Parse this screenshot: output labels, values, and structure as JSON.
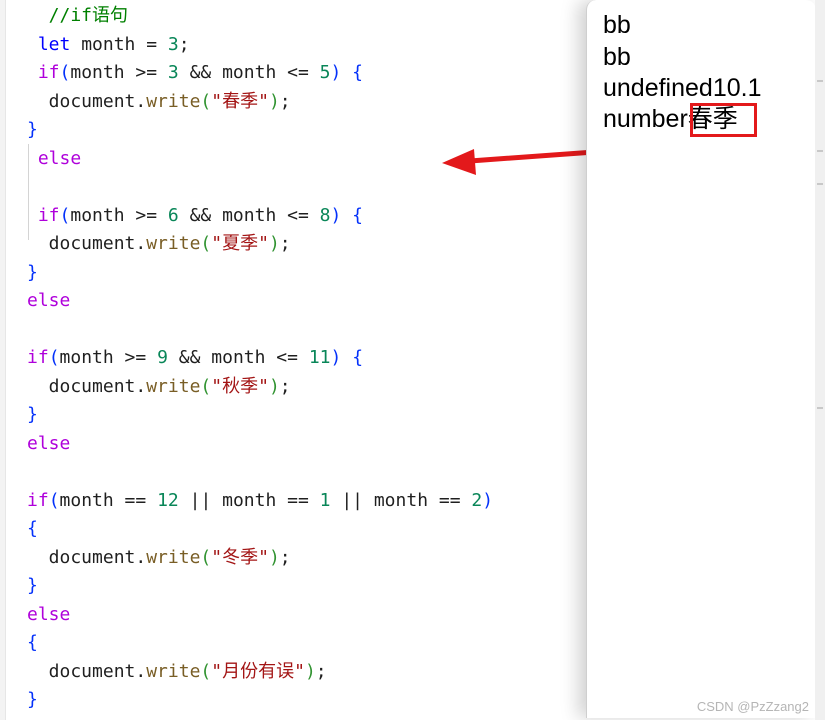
{
  "editor": {
    "lines": [
      {
        "parts": [
          {
            "t": "  //if语句",
            "c": "cmt"
          }
        ]
      },
      {
        "parts": [
          {
            "t": " let",
            "c": "decl"
          },
          {
            "t": " month = ",
            "c": "op"
          },
          {
            "t": "3",
            "c": "num"
          },
          {
            "t": ";",
            "c": "op"
          }
        ]
      },
      {
        "parts": [
          {
            "t": " if",
            "c": "kw"
          },
          {
            "t": "(",
            "c": "br1"
          },
          {
            "t": "month >= ",
            "c": "op"
          },
          {
            "t": "3",
            "c": "num"
          },
          {
            "t": " && month <= ",
            "c": "op"
          },
          {
            "t": "5",
            "c": "num"
          },
          {
            "t": ")",
            "c": "br1"
          },
          {
            "t": " ",
            "c": "op"
          },
          {
            "t": "{",
            "c": "br1"
          }
        ]
      },
      {
        "parts": [
          {
            "t": "  document.",
            "c": "op"
          },
          {
            "t": "write",
            "c": "fn"
          },
          {
            "t": "(",
            "c": "br2"
          },
          {
            "t": "\"春季\"",
            "c": "str"
          },
          {
            "t": ")",
            "c": "br2"
          },
          {
            "t": ";",
            "c": "op"
          }
        ]
      },
      {
        "parts": [
          {
            "t": "}",
            "c": "br1"
          }
        ]
      },
      {
        "parts": [
          {
            "t": " else",
            "c": "kw"
          }
        ]
      },
      {
        "parts": [
          {
            "t": "",
            "c": "op"
          }
        ]
      },
      {
        "parts": [
          {
            "t": " if",
            "c": "kw"
          },
          {
            "t": "(",
            "c": "br1"
          },
          {
            "t": "month >= ",
            "c": "op"
          },
          {
            "t": "6",
            "c": "num"
          },
          {
            "t": " && month <= ",
            "c": "op"
          },
          {
            "t": "8",
            "c": "num"
          },
          {
            "t": ")",
            "c": "br1"
          },
          {
            "t": " ",
            "c": "op"
          },
          {
            "t": "{",
            "c": "br1"
          }
        ]
      },
      {
        "parts": [
          {
            "t": "  document.",
            "c": "op"
          },
          {
            "t": "write",
            "c": "fn"
          },
          {
            "t": "(",
            "c": "br2"
          },
          {
            "t": "\"夏季\"",
            "c": "str"
          },
          {
            "t": ")",
            "c": "br2"
          },
          {
            "t": ";",
            "c": "op"
          }
        ]
      },
      {
        "parts": [
          {
            "t": "}",
            "c": "br1"
          }
        ]
      },
      {
        "parts": [
          {
            "t": "else",
            "c": "kw"
          }
        ]
      },
      {
        "parts": [
          {
            "t": "",
            "c": "op"
          }
        ]
      },
      {
        "parts": [
          {
            "t": "if",
            "c": "kw"
          },
          {
            "t": "(",
            "c": "br1"
          },
          {
            "t": "month >= ",
            "c": "op"
          },
          {
            "t": "9",
            "c": "num"
          },
          {
            "t": " && month <= ",
            "c": "op"
          },
          {
            "t": "11",
            "c": "num"
          },
          {
            "t": ")",
            "c": "br1"
          },
          {
            "t": " ",
            "c": "op"
          },
          {
            "t": "{",
            "c": "br1"
          }
        ]
      },
      {
        "parts": [
          {
            "t": "  document.",
            "c": "op"
          },
          {
            "t": "write",
            "c": "fn"
          },
          {
            "t": "(",
            "c": "br2"
          },
          {
            "t": "\"秋季\"",
            "c": "str"
          },
          {
            "t": ")",
            "c": "br2"
          },
          {
            "t": ";",
            "c": "op"
          }
        ]
      },
      {
        "parts": [
          {
            "t": "}",
            "c": "br1"
          }
        ]
      },
      {
        "parts": [
          {
            "t": "else",
            "c": "kw"
          }
        ]
      },
      {
        "parts": [
          {
            "t": "",
            "c": "op"
          }
        ]
      },
      {
        "parts": [
          {
            "t": "if",
            "c": "kw"
          },
          {
            "t": "(",
            "c": "br1"
          },
          {
            "t": "month == ",
            "c": "op"
          },
          {
            "t": "12",
            "c": "num"
          },
          {
            "t": " || month == ",
            "c": "op"
          },
          {
            "t": "1",
            "c": "num"
          },
          {
            "t": " || month == ",
            "c": "op"
          },
          {
            "t": "2",
            "c": "num"
          },
          {
            "t": ")",
            "c": "br1"
          }
        ]
      },
      {
        "parts": [
          {
            "t": "{",
            "c": "br1"
          }
        ]
      },
      {
        "parts": [
          {
            "t": "  document.",
            "c": "op"
          },
          {
            "t": "write",
            "c": "fn"
          },
          {
            "t": "(",
            "c": "br2"
          },
          {
            "t": "\"冬季\"",
            "c": "str"
          },
          {
            "t": ")",
            "c": "br2"
          },
          {
            "t": ";",
            "c": "op"
          }
        ]
      },
      {
        "parts": [
          {
            "t": "}",
            "c": "br1"
          }
        ]
      },
      {
        "parts": [
          {
            "t": "else",
            "c": "kw"
          }
        ]
      },
      {
        "parts": [
          {
            "t": "{",
            "c": "br1"
          }
        ]
      },
      {
        "parts": [
          {
            "t": "  document.",
            "c": "op"
          },
          {
            "t": "write",
            "c": "fn"
          },
          {
            "t": "(",
            "c": "br2"
          },
          {
            "t": "\"月份有误\"",
            "c": "str"
          },
          {
            "t": ")",
            "c": "br2"
          },
          {
            "t": ";",
            "c": "op"
          }
        ]
      },
      {
        "parts": [
          {
            "t": "}",
            "c": "br1"
          }
        ]
      }
    ]
  },
  "preview": {
    "output_lines": [
      "bb",
      "bb",
      "undefined10.1",
      "number春季"
    ]
  },
  "annotation": {
    "arrow_color": "#e3191b",
    "box_color": "#e3191b"
  },
  "watermark": "CSDN @PzZzang2"
}
